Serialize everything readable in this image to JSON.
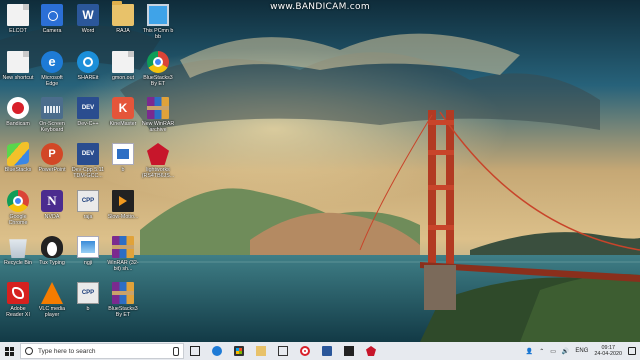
{
  "watermark": "www.BANDICAM.com",
  "desktop": {
    "icons": [
      {
        "label": "ELCOT",
        "icon": "document-icon"
      },
      {
        "label": "Camera",
        "icon": "camera-icon"
      },
      {
        "label": "Word",
        "icon": "word-icon"
      },
      {
        "label": "RAJA",
        "icon": "folder-icon"
      },
      {
        "label": "This PCmn b\nbb",
        "icon": "this-pc-icon"
      },
      {
        "label": "New shortcut",
        "icon": "shortcut-icon"
      },
      {
        "label": "Microsoft\nEdge",
        "icon": "edge-icon"
      },
      {
        "label": "SHAREit",
        "icon": "shareit-icon"
      },
      {
        "label": "gmon.out",
        "icon": "file-icon"
      },
      {
        "label": "BlueStacks3\nBy ET",
        "icon": "bluestacks-chrome-icon"
      },
      {
        "label": "Bandicam",
        "icon": "bandicam-icon"
      },
      {
        "label": "On-Screen\nKeyboard",
        "icon": "keyboard-icon"
      },
      {
        "label": "Dev-C++",
        "icon": "devcpp-icon"
      },
      {
        "label": "KineMaster",
        "icon": "kinemaster-icon"
      },
      {
        "label": "New WinRAR\narchive",
        "icon": "winrar-icon"
      },
      {
        "label": "BlueStacks",
        "icon": "bluestacks-icon"
      },
      {
        "label": "PowerPoint",
        "icon": "powerpoint-icon"
      },
      {
        "label": "Dev-Cpp 5.11\nTDM-GCC...",
        "icon": "devcpp-icon"
      },
      {
        "label": "b",
        "icon": "image-file-icon"
      },
      {
        "label": "lightworks\n(RS4TB6JS...",
        "icon": "ruby-icon"
      },
      {
        "label": "Google\nChrome",
        "icon": "chrome-icon"
      },
      {
        "label": "NVDA",
        "icon": "nvda-icon"
      },
      {
        "label": "raja",
        "icon": "cpp-file-icon"
      },
      {
        "label": "Slow-Motio...",
        "icon": "video-icon"
      },
      {
        "label": "Recycle Bin",
        "icon": "recycle-bin-icon"
      },
      {
        "label": "Tux Typing",
        "icon": "tux-icon"
      },
      {
        "label": "ngji",
        "icon": "picture-icon"
      },
      {
        "label": "WinRAR (32-\nbit) sh...",
        "icon": "winrar-icon"
      },
      {
        "label": "Adobe\nReader XI",
        "icon": "adobe-reader-icon"
      },
      {
        "label": "VLC media\nplayer",
        "icon": "vlc-icon"
      },
      {
        "label": "b",
        "icon": "cpp-file-icon"
      },
      {
        "label": "BlueStacks3\nBy ET",
        "icon": "winrar-icon"
      }
    ]
  },
  "taskbar": {
    "search_placeholder": "Type here to search",
    "pinned": [
      "task-view-icon",
      "edge-icon",
      "store-icon",
      "file-explorer-icon",
      "mail-icon",
      "bandicam-icon",
      "word-icon",
      "video-icon",
      "ruby-icon"
    ],
    "tray": {
      "language": "ENG",
      "time": "09:17",
      "date": "24-04-2020"
    }
  },
  "colors": {
    "taskbar_bg": "#e7eaef",
    "bridge": "#c8442a",
    "sky": "#2f6f8a"
  }
}
